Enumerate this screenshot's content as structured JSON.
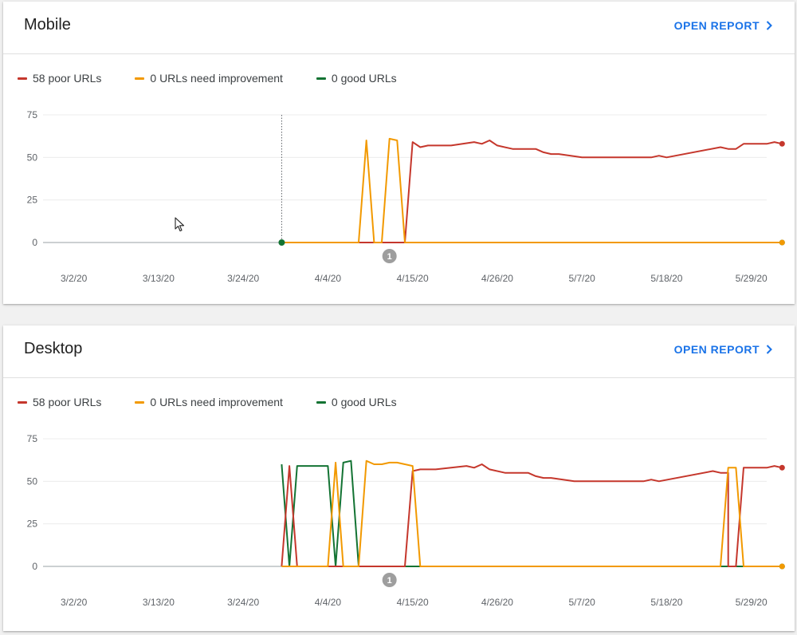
{
  "colors": {
    "poor": "#c5372c",
    "needs_improvement": "#f29900",
    "good": "#137333",
    "link": "#1a73e8"
  },
  "cards": [
    {
      "id": "mobile",
      "title": "Mobile",
      "open_report_label": "OPEN REPORT",
      "legend": [
        {
          "label": "58 poor URLs",
          "series": "poor"
        },
        {
          "label": "0 URLs need improvement",
          "series": "needs_improvement"
        },
        {
          "label": "0 good URLs",
          "series": "good"
        }
      ]
    },
    {
      "id": "desktop",
      "title": "Desktop",
      "open_report_label": "OPEN REPORT",
      "legend": [
        {
          "label": "58 poor URLs",
          "series": "poor"
        },
        {
          "label": "0 URLs need improvement",
          "series": "needs_improvement"
        },
        {
          "label": "0 good URLs",
          "series": "good"
        }
      ]
    }
  ],
  "chart_data": [
    {
      "type": "line",
      "title": "",
      "x_tick_labels": [
        "3/2/20",
        "3/13/20",
        "3/24/20",
        "4/4/20",
        "4/15/20",
        "4/26/20",
        "5/7/20",
        "5/18/20",
        "5/29/20"
      ],
      "x_range": [
        "2/27/20",
        "5/31/20"
      ],
      "y_ticks": [
        0,
        25,
        50,
        75
      ],
      "ylim": [
        0,
        75
      ],
      "grid": true,
      "legend_position": "top-left",
      "marker": {
        "date": "3/29/20",
        "style": "dotted-vertical-line"
      },
      "annotations": [
        {
          "date": "4/12/20",
          "label": "1"
        }
      ],
      "series": [
        {
          "name": "58 poor URLs",
          "key": "poor",
          "points": [
            [
              "3/29/20",
              0
            ],
            [
              "4/14/20",
              0
            ],
            [
              "4/15/20",
              59
            ],
            [
              "4/16/20",
              56
            ],
            [
              "4/17/20",
              57
            ],
            [
              "4/20/20",
              57
            ],
            [
              "4/23/20",
              59
            ],
            [
              "4/24/20",
              58
            ],
            [
              "4/25/20",
              60
            ],
            [
              "4/26/20",
              57
            ],
            [
              "4/28/20",
              55
            ],
            [
              "5/1/20",
              55
            ],
            [
              "5/2/20",
              53
            ],
            [
              "5/3/20",
              52
            ],
            [
              "5/4/20",
              52
            ],
            [
              "5/7/20",
              50
            ],
            [
              "5/16/20",
              50
            ],
            [
              "5/17/20",
              51
            ],
            [
              "5/18/20",
              50
            ],
            [
              "5/25/20",
              56
            ],
            [
              "5/26/20",
              55
            ],
            [
              "5/27/20",
              55
            ],
            [
              "5/28/20",
              58
            ],
            [
              "5/31/20",
              58
            ],
            [
              "6/1/20",
              59
            ],
            [
              "6/2/20",
              58
            ]
          ]
        },
        {
          "name": "0 URLs need improvement",
          "key": "needs_improvement",
          "points": [
            [
              "3/29/20",
              0
            ],
            [
              "4/8/20",
              0
            ],
            [
              "4/9/20",
              60
            ],
            [
              "4/10/20",
              0
            ],
            [
              "4/11/20",
              0
            ],
            [
              "4/12/20",
              61
            ],
            [
              "4/13/20",
              60
            ],
            [
              "4/14/20",
              0
            ],
            [
              "6/2/20",
              0
            ]
          ]
        },
        {
          "name": "0 good URLs",
          "key": "good",
          "points": [
            [
              "3/29/20",
              0
            ],
            [
              "6/2/20",
              0
            ]
          ]
        }
      ]
    },
    {
      "type": "line",
      "title": "",
      "x_tick_labels": [
        "3/2/20",
        "3/13/20",
        "3/24/20",
        "4/4/20",
        "4/15/20",
        "4/26/20",
        "5/7/20",
        "5/18/20",
        "5/29/20"
      ],
      "x_range": [
        "2/27/20",
        "5/31/20"
      ],
      "y_ticks": [
        0,
        25,
        50,
        75
      ],
      "ylim": [
        0,
        75
      ],
      "grid": true,
      "legend_position": "top-left",
      "annotations": [
        {
          "date": "4/12/20",
          "label": "1"
        }
      ],
      "series": [
        {
          "name": "58 poor URLs",
          "key": "poor",
          "points": [
            [
              "3/29/20",
              0
            ],
            [
              "3/30/20",
              59
            ],
            [
              "3/31/20",
              0
            ],
            [
              "4/14/20",
              0
            ],
            [
              "4/15/20",
              56
            ],
            [
              "4/16/20",
              57
            ],
            [
              "4/18/20",
              57
            ],
            [
              "4/20/20",
              58
            ],
            [
              "4/22/20",
              59
            ],
            [
              "4/23/20",
              58
            ],
            [
              "4/24/20",
              60
            ],
            [
              "4/25/20",
              57
            ],
            [
              "4/27/20",
              55
            ],
            [
              "4/30/20",
              55
            ],
            [
              "5/1/20",
              53
            ],
            [
              "5/2/20",
              52
            ],
            [
              "5/3/20",
              52
            ],
            [
              "5/6/20",
              50
            ],
            [
              "5/15/20",
              50
            ],
            [
              "5/16/20",
              51
            ],
            [
              "5/17/20",
              50
            ],
            [
              "5/24/20",
              56
            ],
            [
              "5/25/20",
              55
            ],
            [
              "5/26/20",
              55
            ],
            [
              "5/26/20",
              0
            ],
            [
              "5/27/20",
              0
            ],
            [
              "5/28/20",
              58
            ],
            [
              "5/31/20",
              58
            ],
            [
              "6/1/20",
              59
            ],
            [
              "6/2/20",
              58
            ]
          ]
        },
        {
          "name": "0 URLs need improvement",
          "key": "needs_improvement",
          "points": [
            [
              "3/29/20",
              0
            ],
            [
              "4/4/20",
              0
            ],
            [
              "4/5/20",
              61
            ],
            [
              "4/6/20",
              0
            ],
            [
              "4/8/20",
              0
            ],
            [
              "4/9/20",
              62
            ],
            [
              "4/10/20",
              60
            ],
            [
              "4/11/20",
              60
            ],
            [
              "4/12/20",
              61
            ],
            [
              "4/13/20",
              61
            ],
            [
              "4/14/20",
              60
            ],
            [
              "4/15/20",
              59
            ],
            [
              "4/16/20",
              0
            ],
            [
              "5/25/20",
              0
            ],
            [
              "5/26/20",
              58
            ],
            [
              "5/27/20",
              58
            ],
            [
              "5/28/20",
              0
            ],
            [
              "6/2/20",
              0
            ]
          ]
        },
        {
          "name": "0 good URLs",
          "key": "good",
          "points": [
            [
              "3/29/20",
              60
            ],
            [
              "3/30/20",
              0
            ],
            [
              "3/31/20",
              59
            ],
            [
              "4/3/20",
              59
            ],
            [
              "4/4/20",
              59
            ],
            [
              "4/5/20",
              0
            ],
            [
              "4/6/20",
              61
            ],
            [
              "4/7/20",
              62
            ],
            [
              "4/8/20",
              0
            ],
            [
              "6/2/20",
              0
            ]
          ]
        }
      ]
    }
  ]
}
